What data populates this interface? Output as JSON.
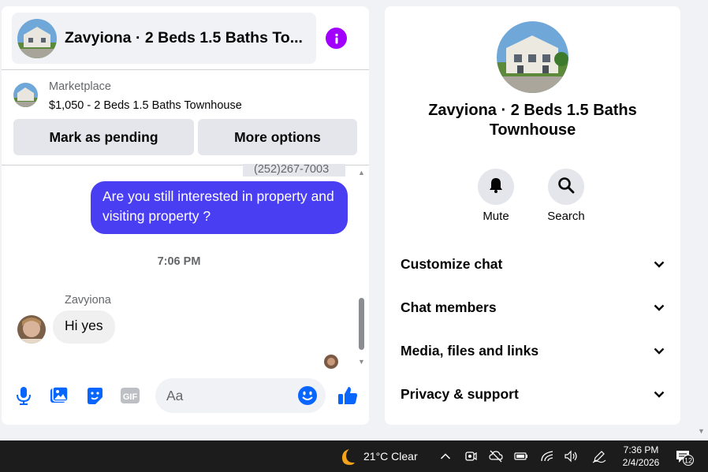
{
  "chat": {
    "title": "Zavyiona · 2 Beds 1.5 Baths To...",
    "info_icon": "info-icon",
    "marketplace_label": "Marketplace",
    "listing": "$1,050 - 2 Beds 1.5 Baths Townhouse",
    "mark_pending": "Mark as pending",
    "more_options": "More options"
  },
  "messages": {
    "partial_phone": "(252)267-7003",
    "outgoing": "Are you still interested in property and visiting property ?",
    "time_separator": "7:06 PM",
    "sender": "Zavyiona",
    "incoming": "Hi yes"
  },
  "composer": {
    "placeholder": "Aa",
    "icons": [
      "mic-icon",
      "photo-icon",
      "sticker-icon",
      "gif-icon",
      "emoji-icon",
      "like-icon"
    ],
    "gif_label": "GIF"
  },
  "info_panel": {
    "title": "Zavyiona · 2 Beds 1.5 Baths Townhouse",
    "mute_label": "Mute",
    "search_label": "Search",
    "sections": [
      "Customize chat",
      "Chat members",
      "Media, files and links",
      "Privacy & support"
    ]
  },
  "taskbar": {
    "weather": "21°C  Clear",
    "time": "7:36 PM",
    "date": "2/4/2026",
    "notifications": "12"
  },
  "colors": {
    "accent_bubble": "#4a3ef2",
    "info_purple": "#a100ff",
    "icon_blue": "#0866ff"
  }
}
